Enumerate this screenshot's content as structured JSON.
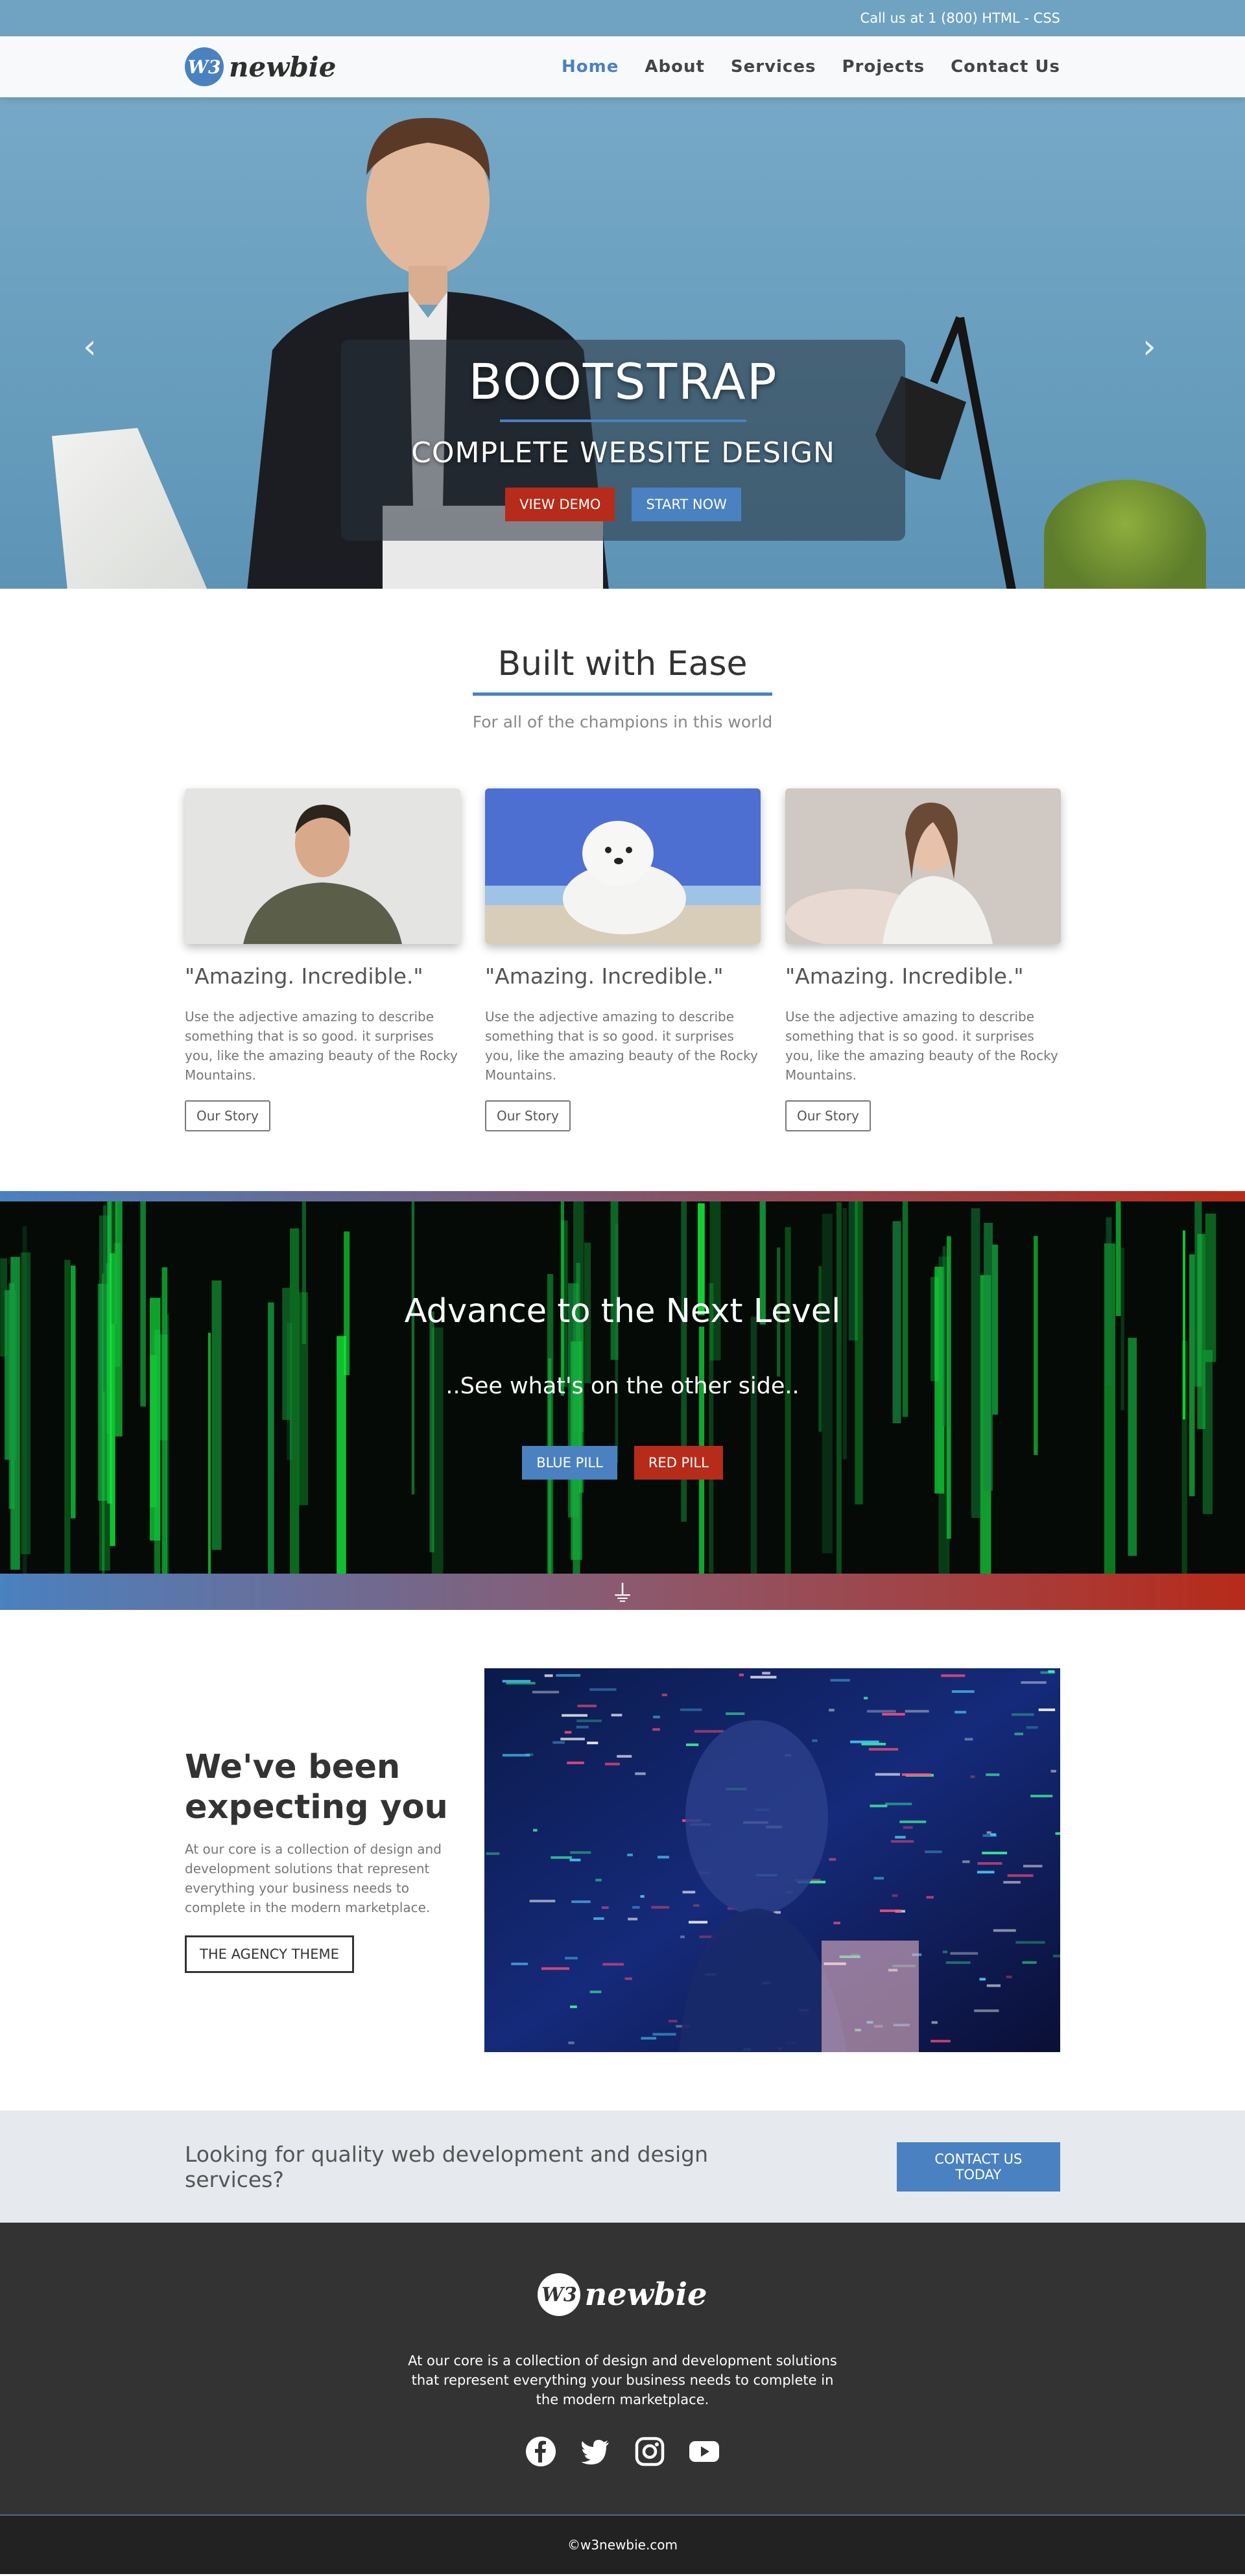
{
  "topbar": {
    "contact": "Call us at 1 (800) HTML - CSS"
  },
  "brand": {
    "badge": "W3",
    "name": "newbie"
  },
  "nav": {
    "items": [
      "Home",
      "About",
      "Services",
      "Projects",
      "Contact Us"
    ],
    "active": "Home"
  },
  "hero": {
    "title": "BOOTSTRAP",
    "subtitle": "COMPLETE WEBSITE DESIGN",
    "btn_demo": "VIEW DEMO",
    "btn_start": "START NOW",
    "prev_icon": "‹",
    "next_icon": "›"
  },
  "ease": {
    "title": "Built with Ease",
    "subtitle": "For all of the champions in this world",
    "cards": [
      {
        "title": "\"Amazing. Incredible.\"",
        "text": "Use the adjective amazing to describe something that is so good. it surprises you, like the amazing beauty of the Rocky Mountains.",
        "button": "Our Story"
      },
      {
        "title": "\"Amazing. Incredible.\"",
        "text": "Use the adjective amazing to describe something that is so good. it surprises you, like the amazing beauty of the Rocky Mountains.",
        "button": "Our Story"
      },
      {
        "title": "\"Amazing. Incredible.\"",
        "text": "Use the adjective amazing to describe something that is so good. it surprises you, like the amazing beauty of the Rocky Mountains.",
        "button": "Our Story"
      }
    ]
  },
  "matrix": {
    "title": "Advance to the Next Level",
    "subtitle": "..See what's on the other side..",
    "btn_blue": "BLUE PILL",
    "btn_red": "RED PILL",
    "plug_icon": "⏚"
  },
  "expect": {
    "title": "We've been expecting you",
    "text": "At our core is a collection of design and development solutions that represent everything your business needs to complete in the modern marketplace.",
    "button": "THE AGENCY THEME"
  },
  "cta": {
    "text": "Looking for quality web development and design services?",
    "button": "CONTACT US TODAY"
  },
  "footer": {
    "text": "At our core is a collection of design and development solutions that represent everything your business needs to complete in the modern marketplace.",
    "socials": [
      "facebook-icon",
      "twitter-icon",
      "instagram-icon",
      "youtube-icon"
    ],
    "copyright": "©w3newbie.com"
  },
  "colors": {
    "accent": "#4a81c0",
    "red": "#b72b1a",
    "topbar": "#6fa3c1",
    "footer": "#333333"
  }
}
